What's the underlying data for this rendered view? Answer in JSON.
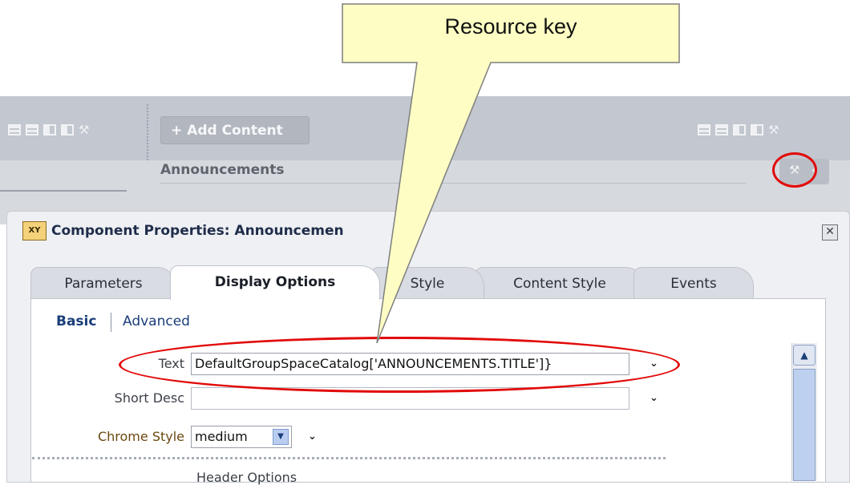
{
  "toolbar": {
    "add_content_label": "+ Add Content"
  },
  "announcements_title": "Announcements",
  "dialog": {
    "icon_text": "XY",
    "title": "Component Properties: Announcemen",
    "close_glyph": "✕"
  },
  "tabs": [
    {
      "label": "Parameters",
      "active": false
    },
    {
      "label": "Display Options",
      "active": true
    },
    {
      "label": "Style",
      "active": false
    },
    {
      "label": "Content Style",
      "active": false
    },
    {
      "label": "Events",
      "active": false
    }
  ],
  "subnav": {
    "basic": "Basic",
    "advanced": "Advanced"
  },
  "fields": {
    "text_label": "Text",
    "text_value": "DefaultGroupSpaceCatalog['ANNOUNCEMENTS.TITLE']}",
    "short_desc_label": "Short Desc",
    "short_desc_value": "",
    "chrome_style_label": "Chrome Style",
    "chrome_style_value": "medium"
  },
  "section_header": "Header Options",
  "callout": {
    "label": "Resource key",
    "color": "#fdfdc4"
  },
  "colors": {
    "highlight_red": "#e20a0a",
    "link_blue": "#1a3e7a"
  }
}
